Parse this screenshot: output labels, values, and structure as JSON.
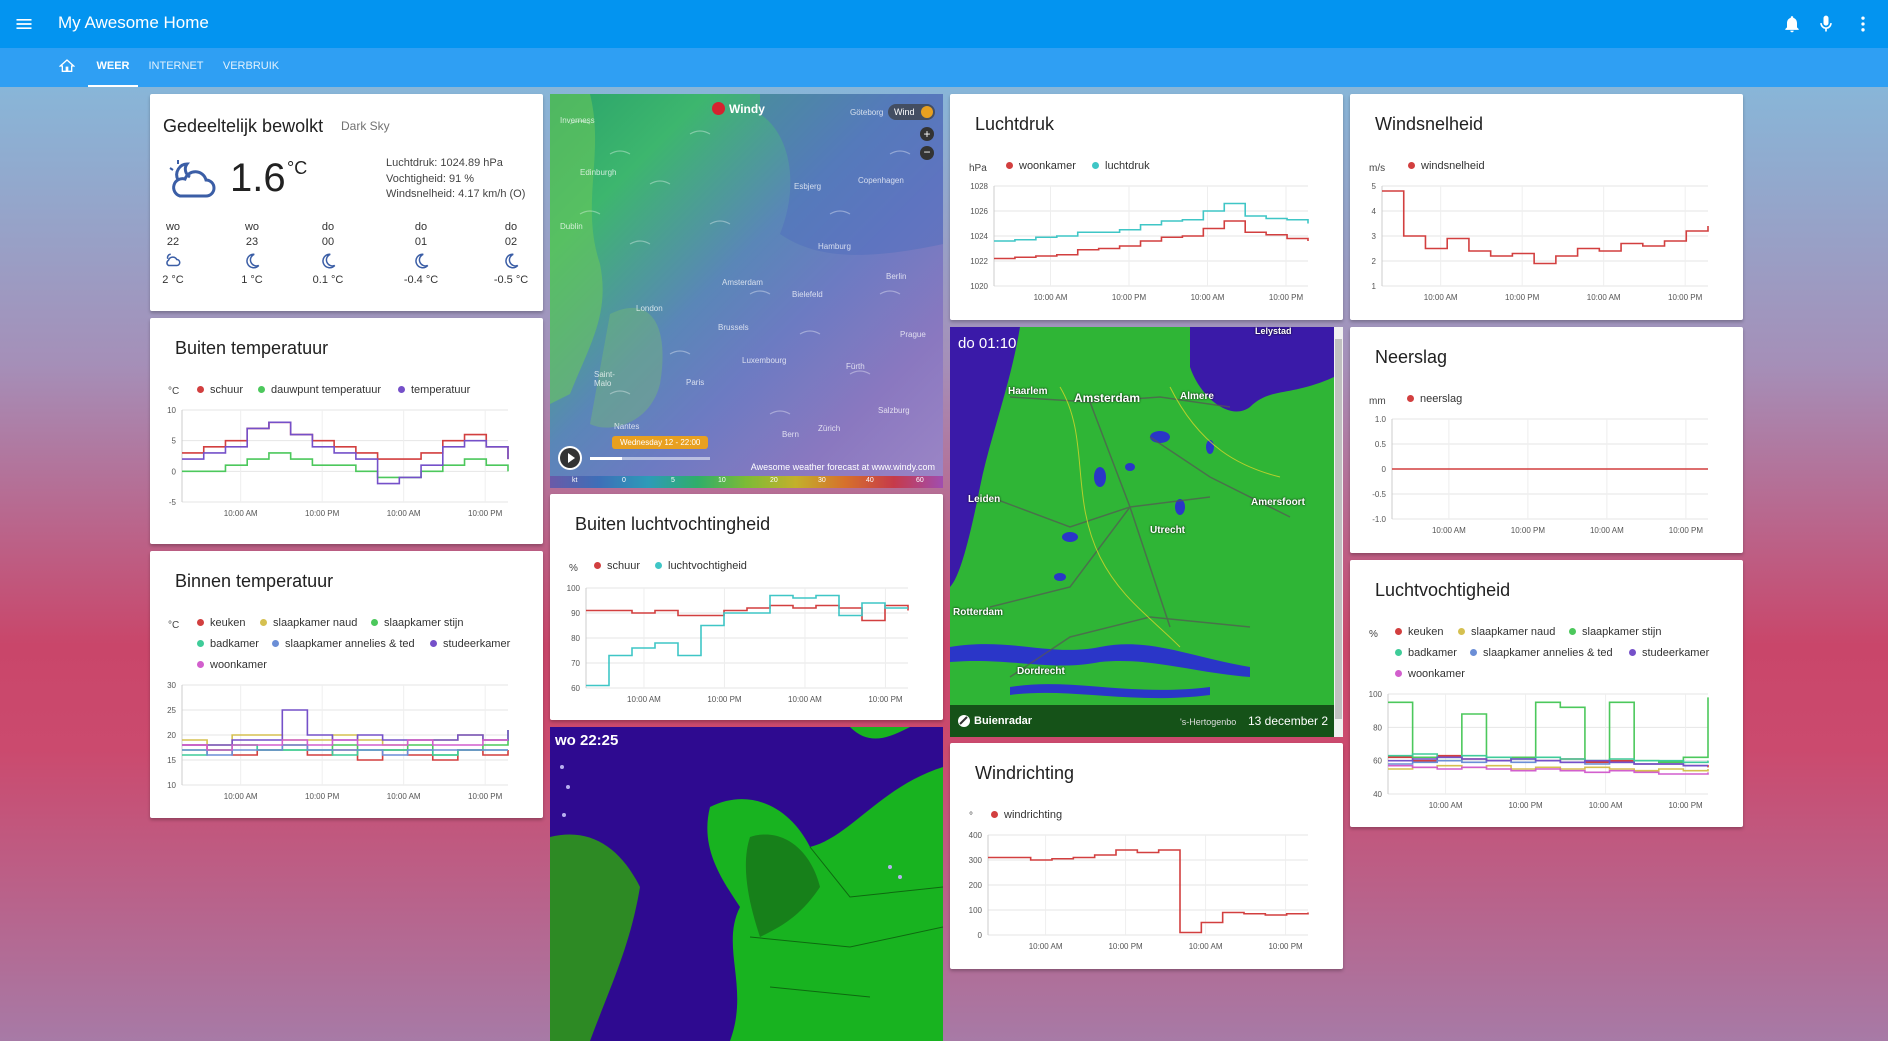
{
  "app": {
    "title": "My Awesome Home"
  },
  "tabs": [
    {
      "label": "WEER"
    },
    {
      "label": "INTERNET"
    },
    {
      "label": "VERBRUIK"
    }
  ],
  "colors": {
    "appbar": "#0394f0",
    "tabs": "#2f9ff3",
    "red": "#d23f3f",
    "green": "#4cc85c",
    "purple": "#7550c9",
    "cyan": "#3fc6c6",
    "yellow": "#d5c050",
    "blue": "#6b8ed6",
    "pink": "#d25fcd"
  },
  "weather": {
    "condition": "Gedeeltelijk bewolkt",
    "source": "Dark Sky",
    "temp": "1.6",
    "unit": "°C",
    "pressure": "Luchtdruk: 1024.89 hPa",
    "humidity": "Vochtigheid: 91 %",
    "wind": "Windsnelheid: 4.17 km/h (O)",
    "forecast": [
      {
        "day": "wo",
        "date": "22",
        "temp": "2 °C",
        "icon": "partly-cloudy-night-icon"
      },
      {
        "day": "wo",
        "date": "23",
        "temp": "1 °C",
        "icon": "moon-icon"
      },
      {
        "day": "do",
        "date": "00",
        "temp": "0.1 °C",
        "icon": "moon-icon"
      },
      {
        "day": "do",
        "date": "01",
        "temp": "-0.4 °C",
        "icon": "moon-icon"
      },
      {
        "day": "do",
        "date": "02",
        "temp": "-0.5 °C",
        "icon": "moon-icon"
      }
    ]
  },
  "windy": {
    "brand": "Windy",
    "layer": "Wind",
    "timestamp": "Wednesday 12 - 22:00",
    "credit": "Awesome weather forecast at www.windy.com",
    "scale_unit": "kt",
    "scale": [
      "0",
      "5",
      "10",
      "20",
      "30",
      "40",
      "60"
    ],
    "cities": [
      "Inverness",
      "Göteborg",
      "Edinburgh",
      "Esbjerg",
      "Copenhagen",
      "Dublin",
      "Hamburg",
      "Amsterdam",
      "Berlin",
      "London",
      "Bielefeld",
      "Brussels",
      "Prague",
      "Luxembourg",
      "Fürth",
      "Saint-Malo",
      "Paris",
      "Nantes",
      "Bern",
      "Zürich",
      "Salzburg"
    ]
  },
  "radar1": {
    "time": "do 01:10",
    "brand": "Buienradar",
    "date": "13 december 2",
    "cities": [
      "Lelystad",
      "Haarlem",
      "Amsterdam",
      "Almere",
      "Leiden",
      "Amersfoort",
      "Utrecht",
      "Rotterdam",
      "Dordrecht",
      "'s-Hertogenbo"
    ]
  },
  "radar2": {
    "time": "wo 22:25"
  },
  "charts": {
    "buiten_temp": {
      "title": "Buiten temperatuur",
      "unit": "°C",
      "series": [
        {
          "name": "schuur"
        },
        {
          "name": "dauwpunt temperatuur"
        },
        {
          "name": "temperatuur"
        }
      ],
      "xticks": [
        "10:00 AM",
        "10:00 PM",
        "10:00 AM",
        "10:00 PM"
      ],
      "yticks": [
        "10",
        "5",
        "0",
        "-5"
      ]
    },
    "binnen_temp": {
      "title": "Binnen temperatuur",
      "unit": "°C",
      "series": [
        {
          "name": "keuken"
        },
        {
          "name": "slaapkamer naud"
        },
        {
          "name": "slaapkamer stijn"
        },
        {
          "name": "badkamer"
        },
        {
          "name": "slaapkamer annelies & ted"
        },
        {
          "name": "studeerkamer"
        },
        {
          "name": "woonkamer"
        }
      ],
      "xticks": [
        "10:00 AM",
        "10:00 PM",
        "10:00 AM",
        "10:00 PM"
      ],
      "yticks": [
        "30",
        "25",
        "20",
        "15",
        "10"
      ]
    },
    "buiten_lv": {
      "title": "Buiten luchtvochtingheid",
      "unit": "%",
      "series": [
        {
          "name": "schuur"
        },
        {
          "name": "luchtvochtigheid"
        }
      ],
      "xticks": [
        "10:00 AM",
        "10:00 PM",
        "10:00 AM",
        "10:00 PM"
      ],
      "yticks": [
        "100",
        "90",
        "80",
        "70",
        "60"
      ]
    },
    "luchtdruk": {
      "title": "Luchtdruk",
      "unit": "hPa",
      "series": [
        {
          "name": "woonkamer"
        },
        {
          "name": "luchtdruk"
        }
      ],
      "xticks": [
        "10:00 AM",
        "10:00 PM",
        "10:00 AM",
        "10:00 PM"
      ],
      "yticks": [
        "1028",
        "1026",
        "1024",
        "1022",
        "1020"
      ]
    },
    "windrichting": {
      "title": "Windrichting",
      "unit": "°",
      "series": [
        {
          "name": "windrichting"
        }
      ],
      "xticks": [
        "10:00 AM",
        "10:00 PM",
        "10:00 AM",
        "10:00 PM"
      ],
      "yticks": [
        "400",
        "300",
        "200",
        "100",
        "0"
      ]
    },
    "windsnelheid": {
      "title": "Windsnelheid",
      "unit": "m/s",
      "series": [
        {
          "name": "windsnelheid"
        }
      ],
      "xticks": [
        "10:00 AM",
        "10:00 PM",
        "10:00 AM",
        "10:00 PM"
      ],
      "yticks": [
        "5",
        "4",
        "3",
        "2",
        "1"
      ]
    },
    "neerslag": {
      "title": "Neerslag",
      "unit": "mm",
      "series": [
        {
          "name": "neerslag"
        }
      ],
      "xticks": [
        "10:00 AM",
        "10:00 PM",
        "10:00 AM",
        "10:00 PM"
      ],
      "yticks": [
        "1.0",
        "0.5",
        "0",
        "-0.5",
        "-1.0"
      ]
    },
    "luchtvochtigheid": {
      "title": "Luchtvochtigheid",
      "unit": "%",
      "series": [
        {
          "name": "keuken"
        },
        {
          "name": "slaapkamer naud"
        },
        {
          "name": "slaapkamer stijn"
        },
        {
          "name": "badkamer"
        },
        {
          "name": "slaapkamer annelies & ted"
        },
        {
          "name": "studeerkamer"
        },
        {
          "name": "woonkamer"
        }
      ],
      "xticks": [
        "10:00 AM",
        "10:00 PM",
        "10:00 AM",
        "10:00 PM"
      ],
      "yticks": [
        "100",
        "80",
        "60",
        "40"
      ]
    }
  },
  "chart_data": [
    {
      "type": "line",
      "title": "Buiten temperatuur",
      "ylabel": "°C",
      "ylim": [
        -5,
        10
      ],
      "x": [
        "10:00 AM",
        "10:00 PM",
        "10:00 AM",
        "10:00 PM"
      ],
      "series": [
        {
          "name": "schuur",
          "color": "#d23f3f",
          "values": [
            3,
            4,
            5,
            7,
            8,
            6,
            5,
            4,
            3,
            2,
            2,
            3,
            5,
            6,
            4,
            2
          ]
        },
        {
          "name": "dauwpunt temperatuur",
          "color": "#4cc85c",
          "values": [
            0,
            0,
            1,
            2,
            3,
            2,
            1,
            1,
            0,
            -1,
            -1,
            0,
            1,
            2,
            1,
            0
          ]
        },
        {
          "name": "temperatuur",
          "color": "#7550c9",
          "values": [
            2,
            3,
            4,
            7,
            8,
            6,
            4,
            3,
            2,
            -2,
            -1,
            1,
            4,
            5,
            4,
            2
          ]
        }
      ]
    },
    {
      "type": "line",
      "title": "Binnen temperatuur",
      "ylabel": "°C",
      "ylim": [
        10,
        30
      ],
      "x": [
        "10:00 AM",
        "10:00 PM",
        "10:00 AM",
        "10:00 PM"
      ],
      "series": [
        {
          "name": "keuken",
          "color": "#d23f3f",
          "values": [
            18,
            17,
            16,
            17,
            18,
            16,
            17,
            15,
            17,
            16,
            15,
            17,
            16,
            17
          ]
        },
        {
          "name": "slaapkamer naud",
          "color": "#d5c050",
          "values": [
            19,
            18,
            20,
            20,
            19,
            19,
            20,
            19,
            18,
            19,
            19,
            20,
            19,
            19
          ]
        },
        {
          "name": "slaapkamer stijn",
          "color": "#4cc85c",
          "values": [
            17,
            17,
            18,
            17,
            17,
            17,
            18,
            17,
            17,
            18,
            16,
            17,
            18,
            21
          ]
        },
        {
          "name": "badkamer",
          "color": "#3fcc99",
          "values": [
            16,
            17,
            18,
            17,
            17,
            17,
            16,
            17,
            17,
            17,
            16,
            17,
            17,
            17
          ]
        },
        {
          "name": "slaapkamer annelies & ted",
          "color": "#6b8ed6",
          "values": [
            17,
            16,
            17,
            17,
            18,
            17,
            17,
            17,
            16,
            17,
            17,
            17,
            17,
            17
          ]
        },
        {
          "name": "studeerkamer",
          "color": "#7550c9",
          "values": [
            18,
            18,
            19,
            19,
            25,
            20,
            19,
            20,
            19,
            19,
            19,
            20,
            19,
            21
          ]
        },
        {
          "name": "woonkamer",
          "color": "#d25fcd",
          "values": [
            18,
            17,
            18,
            18,
            19,
            18,
            19,
            18,
            18,
            19,
            18,
            18,
            19,
            19
          ]
        }
      ]
    },
    {
      "type": "line",
      "title": "Buiten luchtvochtingheid",
      "ylabel": "%",
      "ylim": [
        60,
        100
      ],
      "x": [
        "10:00 AM",
        "10:00 PM",
        "10:00 AM",
        "10:00 PM"
      ],
      "series": [
        {
          "name": "schuur",
          "color": "#d23f3f",
          "values": [
            91,
            91,
            90,
            91,
            89,
            89,
            91,
            92,
            93,
            92,
            93,
            92,
            87,
            93,
            91
          ]
        },
        {
          "name": "luchtvochtigheid",
          "color": "#3fc6c6",
          "values": [
            61,
            73,
            76,
            78,
            73,
            85,
            90,
            90,
            97,
            96,
            97,
            89,
            94,
            92,
            92
          ]
        }
      ]
    },
    {
      "type": "line",
      "title": "Luchtdruk",
      "ylabel": "hPa",
      "ylim": [
        1020,
        1028
      ],
      "x": [
        "10:00 AM",
        "10:00 PM",
        "10:00 AM",
        "10:00 PM"
      ],
      "series": [
        {
          "name": "woonkamer",
          "color": "#d23f3f",
          "values": [
            1022.2,
            1022.3,
            1022.4,
            1022.5,
            1022.9,
            1023.0,
            1023.2,
            1023.6,
            1023.9,
            1024.0,
            1024.6,
            1025.2,
            1024.3,
            1024.1,
            1023.8,
            1023.6
          ]
        },
        {
          "name": "luchtdruk",
          "color": "#3fc6c6",
          "values": [
            1023.6,
            1023.7,
            1023.9,
            1024.0,
            1024.3,
            1024.3,
            1024.5,
            1024.9,
            1025.2,
            1025.3,
            1026.0,
            1026.6,
            1025.6,
            1025.4,
            1025.3,
            1025.0
          ]
        }
      ]
    },
    {
      "type": "line",
      "title": "Windrichting",
      "ylabel": "°",
      "ylim": [
        0,
        400
      ],
      "x": [
        "10:00 AM",
        "10:00 PM",
        "10:00 AM",
        "10:00 PM"
      ],
      "series": [
        {
          "name": "windrichting",
          "color": "#d23f3f",
          "values": [
            310,
            310,
            300,
            305,
            310,
            320,
            340,
            330,
            340,
            10,
            50,
            90,
            85,
            80,
            85,
            90
          ]
        }
      ]
    },
    {
      "type": "line",
      "title": "Windsnelheid",
      "ylabel": "m/s",
      "ylim": [
        1,
        5
      ],
      "x": [
        "10:00 AM",
        "10:00 PM",
        "10:00 AM",
        "10:00 PM"
      ],
      "series": [
        {
          "name": "windsnelheid",
          "color": "#d23f3f",
          "values": [
            4.8,
            3.0,
            2.5,
            2.9,
            2.4,
            2.2,
            2.3,
            1.9,
            2.2,
            2.5,
            2.4,
            2.7,
            2.6,
            2.8,
            3.2,
            3.4
          ]
        }
      ]
    },
    {
      "type": "line",
      "title": "Neerslag",
      "ylabel": "mm",
      "ylim": [
        -1,
        1
      ],
      "x": [
        "10:00 AM",
        "10:00 PM",
        "10:00 AM",
        "10:00 PM"
      ],
      "series": [
        {
          "name": "neerslag",
          "color": "#d23f3f",
          "values": [
            0,
            0,
            0,
            0,
            0,
            0,
            0,
            0,
            0,
            0,
            0,
            0,
            0,
            0,
            0,
            0
          ]
        }
      ]
    },
    {
      "type": "line",
      "title": "Luchtvochtigheid",
      "ylabel": "%",
      "ylim": [
        40,
        100
      ],
      "x": [
        "10:00 AM",
        "10:00 PM",
        "10:00 AM",
        "10:00 PM"
      ],
      "series": [
        {
          "name": "keuken",
          "color": "#d23f3f",
          "values": [
            62,
            60,
            63,
            61,
            60,
            62,
            60,
            61,
            59,
            60,
            58,
            58,
            57,
            56
          ]
        },
        {
          "name": "slaapkamer naud",
          "color": "#d5c050",
          "values": [
            55,
            56,
            57,
            56,
            57,
            55,
            56,
            55,
            56,
            55,
            54,
            55,
            54,
            55
          ]
        },
        {
          "name": "slaapkamer stijn",
          "color": "#4cc85c",
          "values": [
            95,
            62,
            60,
            88,
            60,
            62,
            95,
            92,
            60,
            95,
            60,
            59,
            62,
            98
          ]
        },
        {
          "name": "badkamer",
          "color": "#3fcc99",
          "values": [
            63,
            64,
            62,
            63,
            62,
            61,
            62,
            61,
            60,
            61,
            60,
            60,
            59,
            60
          ]
        },
        {
          "name": "slaapkamer annelies & ted",
          "color": "#6b8ed6",
          "values": [
            58,
            59,
            60,
            59,
            60,
            59,
            60,
            59,
            58,
            59,
            58,
            58,
            57,
            57
          ]
        },
        {
          "name": "studeerkamer",
          "color": "#7550c9",
          "values": [
            60,
            61,
            62,
            61,
            60,
            61,
            60,
            59,
            60,
            59,
            58,
            58,
            57,
            57
          ]
        },
        {
          "name": "woonkamer",
          "color": "#d25fcd",
          "values": [
            57,
            56,
            55,
            56,
            55,
            54,
            55,
            54,
            53,
            54,
            53,
            52,
            52,
            53
          ]
        }
      ]
    }
  ]
}
